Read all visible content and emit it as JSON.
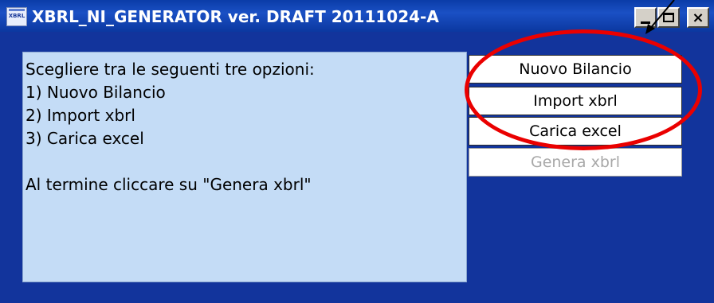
{
  "window": {
    "title": "XBRL_NI_GENERATOR ver. DRAFT 20111024-A",
    "icon_label": "XBRL",
    "controls": {
      "minimize": "minimize-icon",
      "maximize": "maximize-icon",
      "close": "×"
    }
  },
  "instructions": {
    "lines": [
      "Scegliere tra le seguenti tre opzioni:",
      "1) Nuovo Bilancio",
      "2) Import xbrl",
      "3) Carica excel",
      "Al termine cliccare su \"Genera xbrl\""
    ]
  },
  "buttons": {
    "nuovo_bilancio": "Nuovo Bilancio",
    "import_xbrl": "Import xbrl",
    "carica_excel": "Carica excel",
    "genera_xbrl": "Genera xbrl",
    "genera_xbrl_enabled": false
  },
  "annotations": {
    "highlight_color": "#ea0000",
    "arrow_color": "#000000"
  },
  "colors": {
    "titlebar": "#0a3ca8",
    "client_background": "#12349c",
    "panel_background": "#c4dcf6"
  }
}
